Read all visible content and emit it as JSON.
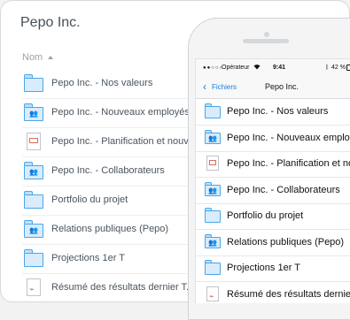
{
  "desktop": {
    "title": "Pepo Inc.",
    "column_header": "Nom",
    "rows": [
      {
        "label": "Pepo Inc. - Nos valeurs",
        "icon": "folder-icon"
      },
      {
        "label": "Pepo Inc. - Nouveaux employés",
        "icon": "shared-folder-icon"
      },
      {
        "label": "Pepo Inc. - Planification et nouveau",
        "icon": "presentation-icon"
      },
      {
        "label": "Pepo Inc. - Collaborateurs",
        "icon": "shared-folder-icon"
      },
      {
        "label": "Portfolio du projet",
        "icon": "folder-icon"
      },
      {
        "label": "Relations publiques (Pepo)",
        "icon": "shared-folder-icon"
      },
      {
        "label": "Projections 1er T",
        "icon": "folder-icon"
      },
      {
        "label": "Résumé des résultats dernier T.pdf",
        "icon": "pdf-icon"
      }
    ]
  },
  "phone": {
    "status": {
      "dots": "●●○○○",
      "carrier": "Opérateur",
      "wifi": "wifi-icon",
      "time": "9:41",
      "bluetooth": "bluetooth-icon",
      "battery_pct": "42 %"
    },
    "nav": {
      "back_label": "Fichiers",
      "title": "Pepo Inc."
    },
    "rows": [
      {
        "label": "Pepo Inc. - Nos valeurs",
        "icon": "folder-icon"
      },
      {
        "label": "Pepo Inc. - Nouveaux employés",
        "icon": "shared-folder-icon"
      },
      {
        "label": "Pepo Inc. - Planification et nouve",
        "icon": "presentation-icon"
      },
      {
        "label": "Pepo Inc. - Collaborateurs",
        "icon": "shared-folder-icon"
      },
      {
        "label": "Portfolio du projet",
        "icon": "folder-icon"
      },
      {
        "label": "Relations publiques (Pepo)",
        "icon": "shared-folder-icon"
      },
      {
        "label": "Projections 1er T",
        "icon": "folder-icon"
      },
      {
        "label": "Résumé des résultats dernier T.",
        "icon": "pdf-icon"
      }
    ]
  }
}
